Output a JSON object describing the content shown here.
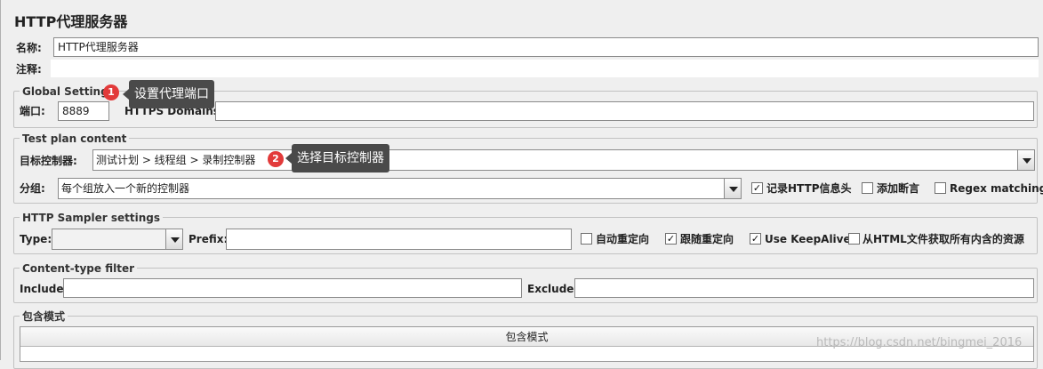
{
  "title": "HTTP代理服务器",
  "name": {
    "label": "名称:",
    "value": "HTTP代理服务器"
  },
  "comment": {
    "label": "注释:",
    "value": ""
  },
  "global_settings": {
    "legend": "Global Settings",
    "port_label": "端口:",
    "port_value": "8889",
    "https_label": "HTTPS Domains :",
    "https_value": ""
  },
  "callouts": [
    {
      "number": "1",
      "text": "设置代理端口"
    },
    {
      "number": "2",
      "text": "选择目标控制器"
    }
  ],
  "test_plan": {
    "legend": "Test plan content",
    "target_label": "目标控制器:",
    "target_value": "测试计划 > 线程组 > 录制控制器",
    "group_label": "分组:",
    "group_value": "每个组放入一个新的控制器",
    "record_headers": {
      "label": "记录HTTP信息头",
      "checked": true
    },
    "add_assertions": {
      "label": "添加断言",
      "checked": false
    },
    "regex_matching": {
      "label": "Regex matching",
      "checked": false
    }
  },
  "sampler": {
    "legend": "HTTP Sampler settings",
    "type_label": "Type:",
    "type_value": "",
    "prefix_label": "Prefix:",
    "prefix_value": "",
    "auto_redirect": {
      "label": "自动重定向",
      "checked": false
    },
    "follow_redirect": {
      "label": "跟随重定向",
      "checked": true
    },
    "keepalive": {
      "label": "Use KeepAlive",
      "checked": true
    },
    "fetch_resources": {
      "label": "从HTML文件获取所有内含的资源",
      "checked": false
    }
  },
  "content_filter": {
    "legend": "Content-type filter",
    "include_label": "Include:",
    "include_value": "",
    "exclude_label": "Exclude:",
    "exclude_value": ""
  },
  "include_patterns": {
    "legend": "包含模式",
    "column_header": "包含模式"
  },
  "watermark": "https://blog.csdn.net/bingmei_2016",
  "colors": {
    "badge": "#e23a3a",
    "callout_bg": "#4a4a4a",
    "panel_bg": "#efefef"
  }
}
